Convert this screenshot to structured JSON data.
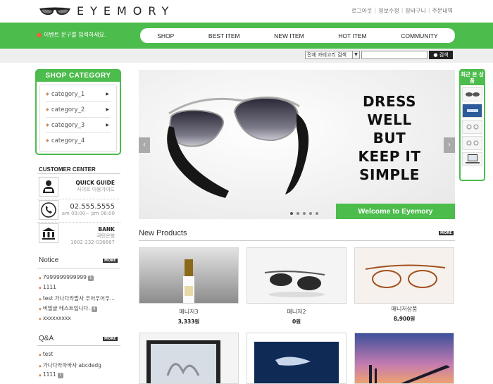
{
  "header": {
    "logo_text": "EYEMORY",
    "links": [
      "로그아웃",
      "정보수정",
      "장바구니",
      "주문내역"
    ]
  },
  "navband": {
    "event_text": "이벤트 문구를 입력하세요.",
    "menu": [
      "SHOP",
      "BEST ITEM",
      "NEW ITEM",
      "HOT ITEM",
      "COMMUNITY"
    ]
  },
  "search": {
    "category_selected": "전체 카테고리 검색",
    "input_value": "",
    "button_label": "검색"
  },
  "shop_category": {
    "title": "SHOP CATEGORY",
    "items": [
      "category_1",
      "category_2",
      "category_3",
      "category_4"
    ]
  },
  "customer_center": {
    "title": "CUSTOMER CENTER",
    "quick_guide_title": "QUICK GUIDE",
    "quick_guide_sub": "사이트 이용가이드",
    "phone": "02.555.5555",
    "hours": "am 09:00~ pm 06:00",
    "bank_title": "BANK",
    "bank_name": "국민은행",
    "bank_account": "1002-232-036667"
  },
  "notice": {
    "title": "Notice",
    "more": "MORE",
    "items": [
      {
        "text": "7999999999999",
        "badge": "1"
      },
      {
        "text": "1111",
        "badge": ""
      },
      {
        "text": "test 가나다라맙사 우어우어우...",
        "badge": ""
      },
      {
        "text": "비밀글 테스트입니다.",
        "badge": "4"
      },
      {
        "text": "xxxxxxxxx",
        "badge": ""
      }
    ]
  },
  "qna": {
    "title": "Q&A",
    "more": "MORE",
    "items": [
      {
        "text": "test",
        "badge": ""
      },
      {
        "text": "가나다라마바사 abcdedg",
        "badge": ""
      },
      {
        "text": "1111",
        "badge": "7"
      }
    ]
  },
  "banner": {
    "slogan": [
      "DRESS",
      "WELL",
      "BUT",
      "KEEP IT",
      "SIMPLE"
    ],
    "welcome": "Welcome to Eyemory",
    "slide_count": 5,
    "active_slide": 1
  },
  "recent": {
    "title": "최근 본 상품"
  },
  "new_products": {
    "title": "New Products",
    "more": "MORE",
    "items": [
      {
        "name": "매니저3",
        "price": "3,333원"
      },
      {
        "name": "매니저2",
        "price": "0원"
      },
      {
        "name": "매니저상품",
        "price": "8,900원"
      }
    ]
  },
  "colors": {
    "brand_green": "#4cbc4c",
    "search_button": "#222222"
  }
}
